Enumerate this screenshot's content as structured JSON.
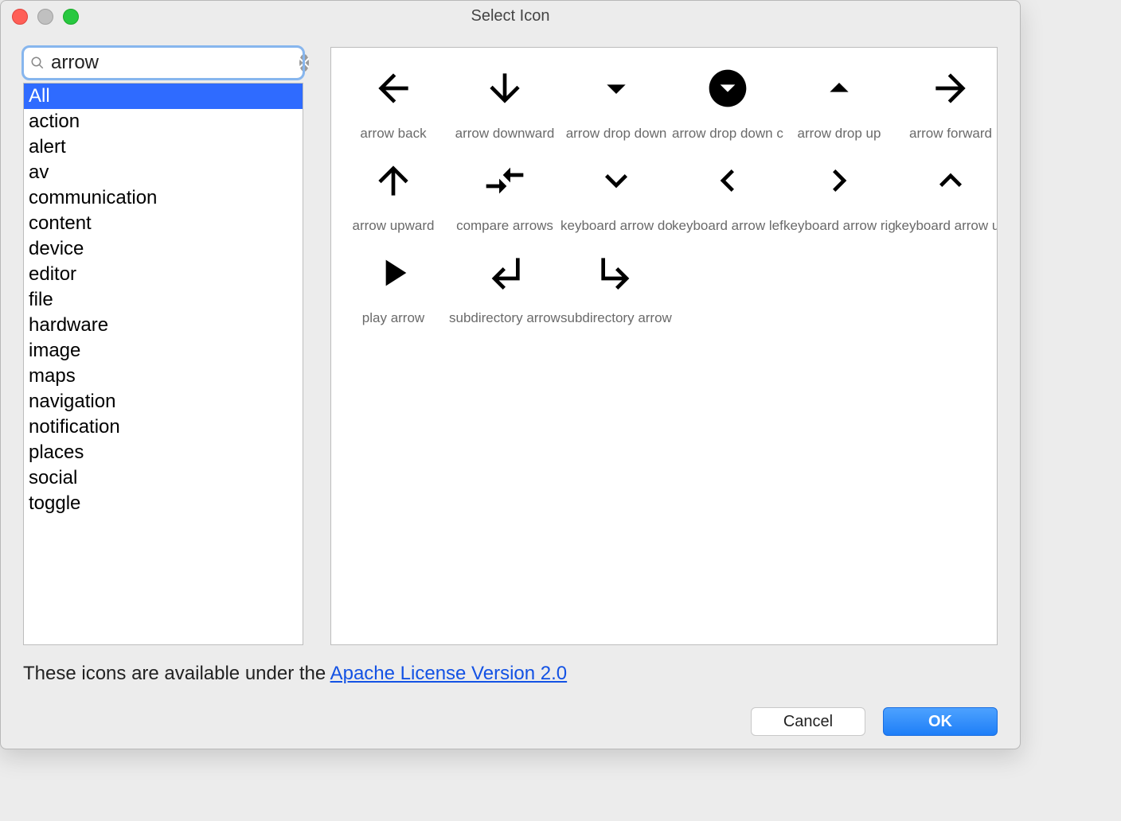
{
  "window": {
    "title": "Select Icon"
  },
  "search": {
    "value": "arrow"
  },
  "categories": {
    "selected_index": 0,
    "items": [
      "All",
      "action",
      "alert",
      "av",
      "communication",
      "content",
      "device",
      "editor",
      "file",
      "hardware",
      "image",
      "maps",
      "navigation",
      "notification",
      "places",
      "social",
      "toggle"
    ]
  },
  "icons": [
    {
      "name": "arrow back",
      "svg": "arrow-back"
    },
    {
      "name": "arrow downward",
      "svg": "arrow-downward"
    },
    {
      "name": "arrow drop down",
      "svg": "arrow-drop-down"
    },
    {
      "name": "arrow drop down circle",
      "svg": "arrow-drop-down-circle"
    },
    {
      "name": "arrow drop up",
      "svg": "arrow-drop-up"
    },
    {
      "name": "arrow forward",
      "svg": "arrow-forward"
    },
    {
      "name": "arrow upward",
      "svg": "arrow-upward"
    },
    {
      "name": "compare arrows",
      "svg": "compare-arrows"
    },
    {
      "name": "keyboard arrow down",
      "svg": "keyboard-arrow-down"
    },
    {
      "name": "keyboard arrow left",
      "svg": "keyboard-arrow-left"
    },
    {
      "name": "keyboard arrow right",
      "svg": "keyboard-arrow-right"
    },
    {
      "name": "keyboard arrow up",
      "svg": "keyboard-arrow-up"
    },
    {
      "name": "play arrow",
      "svg": "play-arrow"
    },
    {
      "name": "subdirectory arrow left",
      "svg": "subdirectory-arrow-left"
    },
    {
      "name": "subdirectory arrow right",
      "svg": "subdirectory-arrow-right"
    }
  ],
  "license": {
    "prefix": "These icons are available under the ",
    "link_text": "Apache License Version 2.0"
  },
  "buttons": {
    "cancel": "Cancel",
    "ok": "OK"
  }
}
